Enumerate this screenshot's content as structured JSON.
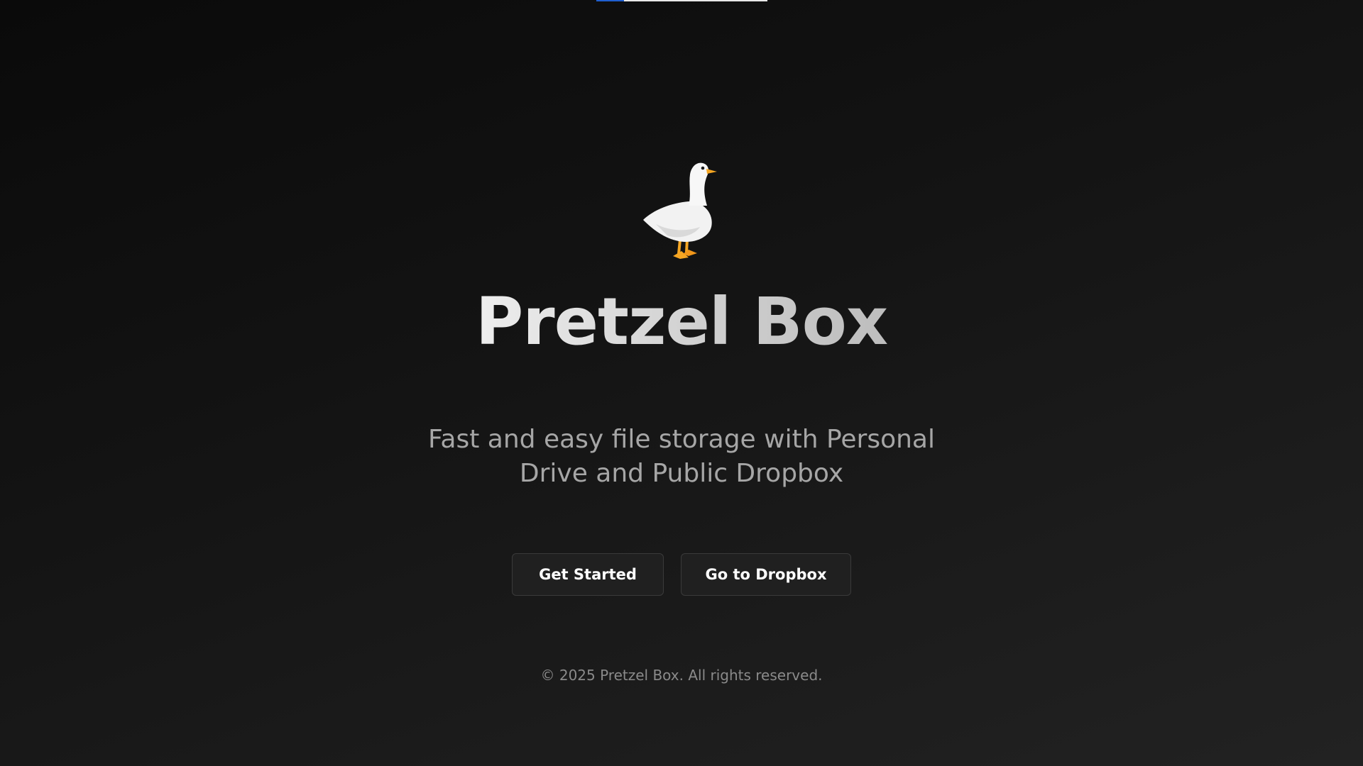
{
  "progress_bar": {
    "fill": 0.16,
    "fill_color": "#1f5fd0",
    "track_color": "#e8e8e8"
  },
  "hero": {
    "logo_icon": "goose-icon",
    "title": "Pretzel Box",
    "subtitle": "Fast and easy file storage with Personal Drive and Public Dropbox"
  },
  "actions": {
    "get_started": "Get Started",
    "go_to_dropbox": "Go to Dropbox"
  },
  "footer": {
    "copyright": "© 2025 Pretzel Box. All rights reserved."
  },
  "colors": {
    "background_dark": "#0a0a0a",
    "background_light": "#222222",
    "button_bg": "#202020",
    "goose_beak": "#f5a623"
  }
}
